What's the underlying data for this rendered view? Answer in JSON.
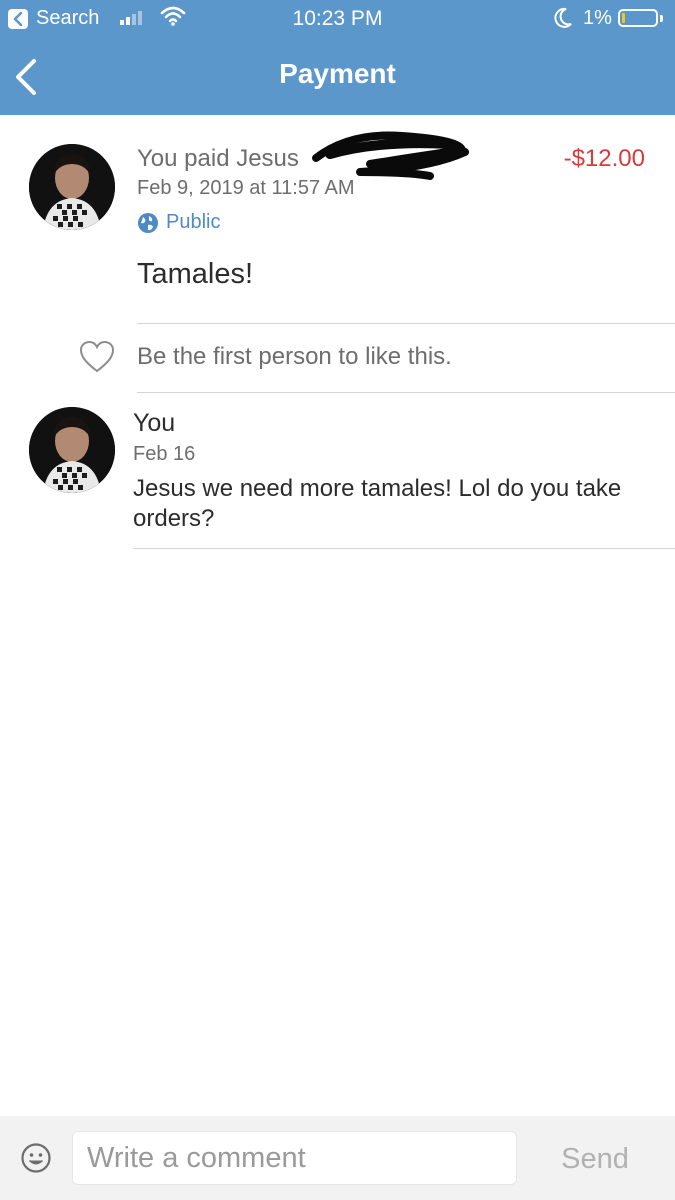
{
  "status_bar": {
    "back_app_label": "Search",
    "time": "10:23 PM",
    "battery_percent": "1%",
    "battery_level": 0.01,
    "signal_bars": 2
  },
  "nav": {
    "title": "Payment",
    "back_icon": "chevron-left-icon"
  },
  "payment": {
    "sender_text": "You paid Jesus",
    "amount": "-$12.00",
    "datetime": "Feb 9, 2019 at 11:57 AM",
    "privacy": "Public",
    "note": "Tamales!",
    "likes_text": "Be the first person to like this."
  },
  "comments": [
    {
      "author": "You",
      "date": "Feb 16",
      "text": "Jesus we need more tamales! Lol do you take orders?"
    }
  ],
  "composer": {
    "placeholder": "Write a comment",
    "send_label": "Send"
  },
  "colors": {
    "header": "#5c97cc",
    "amount": "#d93a3a",
    "link": "#4d8ac6",
    "muted": "#6d6d6d"
  }
}
